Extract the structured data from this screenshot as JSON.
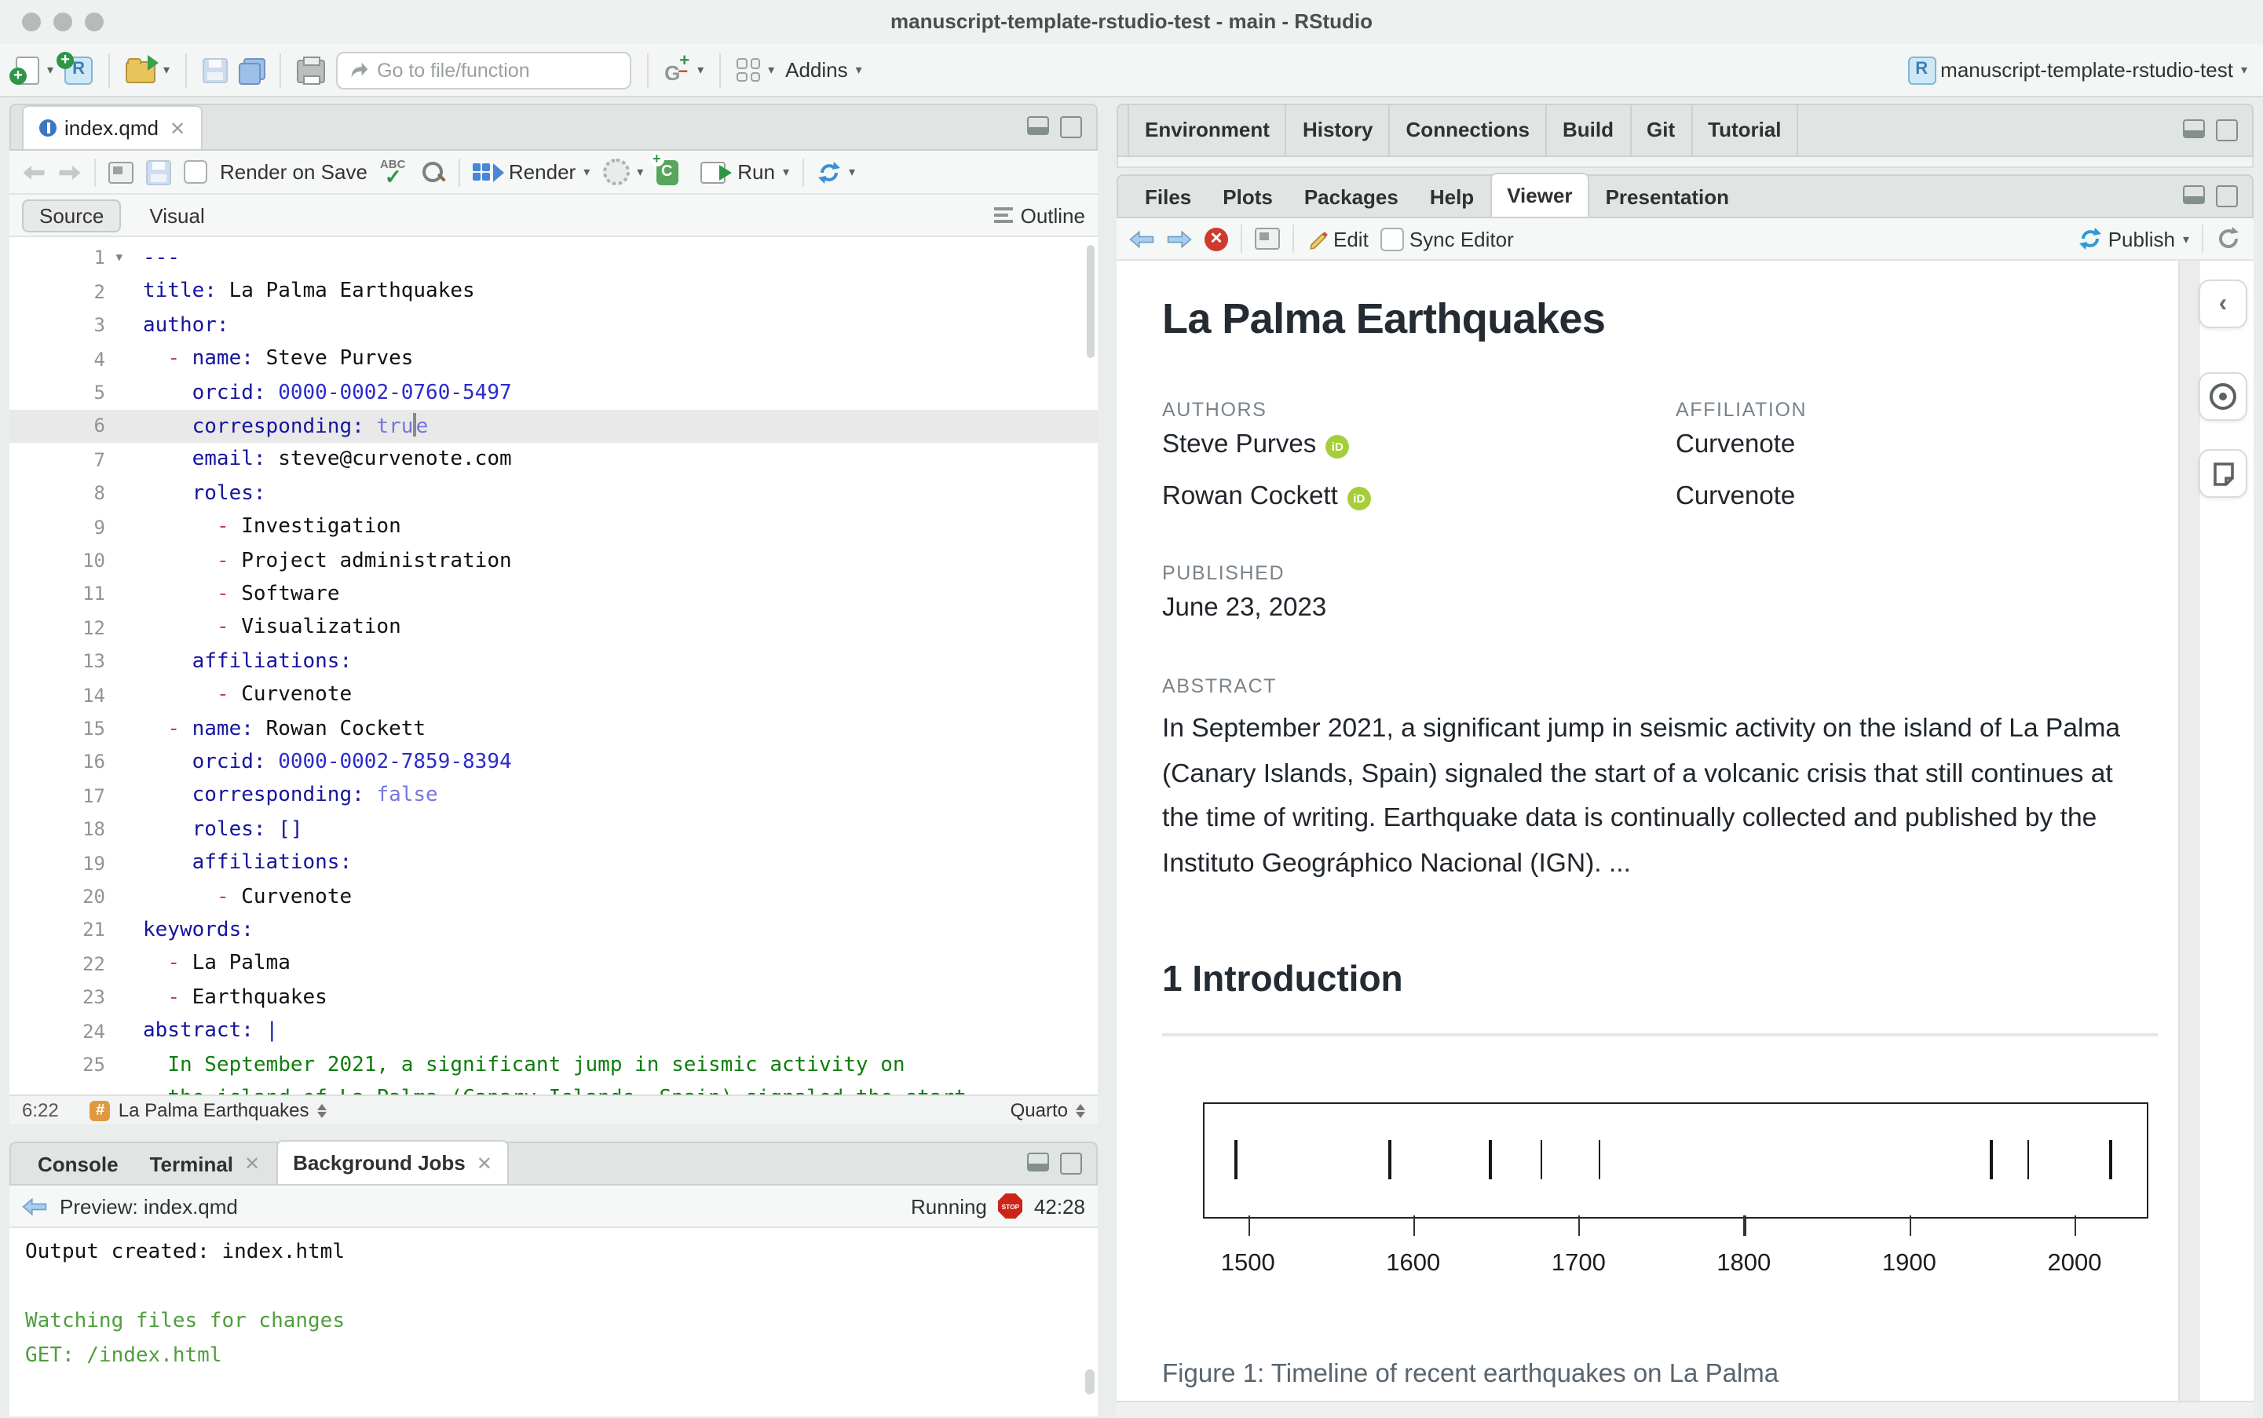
{
  "window": {
    "title": "manuscript-template-rstudio-test - main - RStudio"
  },
  "toolbar": {
    "goto_placeholder": "Go to file/function",
    "addins": "Addins",
    "project": "manuscript-template-rstudio-test"
  },
  "editor": {
    "tab": "index.qmd",
    "render_on_save": "Render on Save",
    "render": "Render",
    "run": "Run",
    "source": "Source",
    "visual": "Visual",
    "outline": "Outline",
    "status": {
      "cursor": "6:22",
      "section": "La Palma Earthquakes",
      "format": "Quarto"
    },
    "lines": [
      {
        "n": "1",
        "fold": true,
        "segs": [
          [
            "---",
            "key"
          ]
        ]
      },
      {
        "n": "2",
        "segs": [
          [
            "title: ",
            "key"
          ],
          [
            "La Palma Earthquakes",
            "val"
          ]
        ]
      },
      {
        "n": "3",
        "segs": [
          [
            "author:",
            "key"
          ]
        ]
      },
      {
        "n": "4",
        "segs": [
          [
            "  ",
            "val"
          ],
          [
            "- ",
            "dash"
          ],
          [
            "name: ",
            "key"
          ],
          [
            "Steve Purves",
            "val"
          ]
        ]
      },
      {
        "n": "5",
        "segs": [
          [
            "    ",
            "val"
          ],
          [
            "orcid: ",
            "key"
          ],
          [
            "0000-0002-0760-5497",
            "num"
          ]
        ]
      },
      {
        "n": "6",
        "active": true,
        "segs": [
          [
            "    ",
            "val"
          ],
          [
            "corresponding: ",
            "key"
          ],
          [
            "tru",
            "bool"
          ],
          [
            "",
            "cursor"
          ],
          [
            "e",
            "bool"
          ]
        ]
      },
      {
        "n": "7",
        "segs": [
          [
            "    ",
            "val"
          ],
          [
            "email: ",
            "key"
          ],
          [
            "steve@curvenote.com",
            "val"
          ]
        ]
      },
      {
        "n": "8",
        "segs": [
          [
            "    ",
            "val"
          ],
          [
            "roles:",
            "key"
          ]
        ]
      },
      {
        "n": "9",
        "segs": [
          [
            "      ",
            "val"
          ],
          [
            "- ",
            "dash"
          ],
          [
            "Investigation",
            "val"
          ]
        ]
      },
      {
        "n": "10",
        "segs": [
          [
            "      ",
            "val"
          ],
          [
            "- ",
            "dash"
          ],
          [
            "Project administration",
            "val"
          ]
        ]
      },
      {
        "n": "11",
        "segs": [
          [
            "      ",
            "val"
          ],
          [
            "- ",
            "dash"
          ],
          [
            "Software",
            "val"
          ]
        ]
      },
      {
        "n": "12",
        "segs": [
          [
            "      ",
            "val"
          ],
          [
            "- ",
            "dash"
          ],
          [
            "Visualization",
            "val"
          ]
        ]
      },
      {
        "n": "13",
        "segs": [
          [
            "    ",
            "val"
          ],
          [
            "affiliations:",
            "key"
          ]
        ]
      },
      {
        "n": "14",
        "segs": [
          [
            "      ",
            "val"
          ],
          [
            "- ",
            "dash"
          ],
          [
            "Curvenote",
            "val"
          ]
        ]
      },
      {
        "n": "15",
        "segs": [
          [
            "  ",
            "val"
          ],
          [
            "- ",
            "dash"
          ],
          [
            "name: ",
            "key"
          ],
          [
            "Rowan Cockett",
            "val"
          ]
        ]
      },
      {
        "n": "16",
        "segs": [
          [
            "    ",
            "val"
          ],
          [
            "orcid: ",
            "key"
          ],
          [
            "0000-0002-7859-8394",
            "num"
          ]
        ]
      },
      {
        "n": "17",
        "segs": [
          [
            "    ",
            "val"
          ],
          [
            "corresponding: ",
            "key"
          ],
          [
            "false",
            "bool"
          ]
        ]
      },
      {
        "n": "18",
        "segs": [
          [
            "    ",
            "val"
          ],
          [
            "roles: ",
            "key"
          ],
          [
            "[]",
            "key"
          ]
        ]
      },
      {
        "n": "19",
        "segs": [
          [
            "    ",
            "val"
          ],
          [
            "affiliations:",
            "key"
          ]
        ]
      },
      {
        "n": "20",
        "segs": [
          [
            "      ",
            "val"
          ],
          [
            "- ",
            "dash"
          ],
          [
            "Curvenote",
            "val"
          ]
        ]
      },
      {
        "n": "21",
        "segs": [
          [
            "keywords:",
            "key"
          ]
        ]
      },
      {
        "n": "22",
        "segs": [
          [
            "  ",
            "val"
          ],
          [
            "- ",
            "dash"
          ],
          [
            "La Palma",
            "val"
          ]
        ]
      },
      {
        "n": "23",
        "segs": [
          [
            "  ",
            "val"
          ],
          [
            "- ",
            "dash"
          ],
          [
            "Earthquakes",
            "val"
          ]
        ]
      },
      {
        "n": "24",
        "segs": [
          [
            "abstract: |",
            "key"
          ]
        ]
      },
      {
        "n": "25",
        "segs": [
          [
            "  ",
            "val"
          ],
          [
            "In September 2021, a significant jump in seismic activity on",
            "str"
          ]
        ]
      },
      {
        "n": "",
        "segs": [
          [
            "  ",
            "val"
          ],
          [
            "the island of La Palma (Canary Islands, Spain) signaled the start",
            "str"
          ]
        ]
      }
    ]
  },
  "console": {
    "tabs": [
      {
        "label": "Console",
        "closable": false,
        "active": false
      },
      {
        "label": "Terminal",
        "closable": true,
        "active": false
      },
      {
        "label": "Background Jobs",
        "closable": true,
        "active": true
      }
    ],
    "preview": "Preview: index.qmd",
    "running": "Running",
    "time": "42:28",
    "output": [
      {
        "text": "Output created: index.html",
        "style": "plain"
      },
      {
        "text": "",
        "style": "plain"
      },
      {
        "text": "Watching files for changes",
        "style": "green"
      },
      {
        "text": "GET: /index.html",
        "style": "green"
      }
    ]
  },
  "right_top_tabs": [
    "Environment",
    "History",
    "Connections",
    "Build",
    "Git",
    "Tutorial"
  ],
  "viewer": {
    "tabs": [
      {
        "label": "Files",
        "active": false
      },
      {
        "label": "Plots",
        "active": false
      },
      {
        "label": "Packages",
        "active": false
      },
      {
        "label": "Help",
        "active": false
      },
      {
        "label": "Viewer",
        "active": true
      },
      {
        "label": "Presentation",
        "active": false
      }
    ],
    "edit": "Edit",
    "sync": "Sync Editor",
    "publish": "Publish",
    "doc": {
      "title": "La Palma Earthquakes",
      "authors_label": "AUTHORS",
      "affiliation_label": "AFFILIATION",
      "authors": [
        {
          "name": "Steve Purves",
          "affiliation": "Curvenote"
        },
        {
          "name": "Rowan Cockett",
          "affiliation": "Curvenote"
        }
      ],
      "published_label": "PUBLISHED",
      "published": "June 23, 2023",
      "abstract_label": "ABSTRACT",
      "abstract": "In September 2021, a significant jump in seismic activity on the island of La Palma (Canary Islands, Spain) signaled the start of a volcanic crisis that still continues at the time of writing. Earthquake data is continually collected and published by the Instituto Geográphico Nacional (IGN). ...",
      "section_heading": "1 Introduction",
      "figure_caption": "Figure 1: Timeline of recent earthquakes on La Palma"
    }
  },
  "chart_data": {
    "type": "scatter",
    "subtype": "rug-timeline",
    "title": "Timeline of recent earthquakes on La Palma",
    "x": [
      1492,
      1585,
      1646,
      1677,
      1712,
      1949,
      1971,
      2021
    ],
    "xticks": [
      1500,
      1600,
      1700,
      1800,
      1900,
      2000
    ],
    "xlim": [
      1473,
      2043
    ],
    "xlabel": "",
    "ylabel": "",
    "grid": false
  }
}
